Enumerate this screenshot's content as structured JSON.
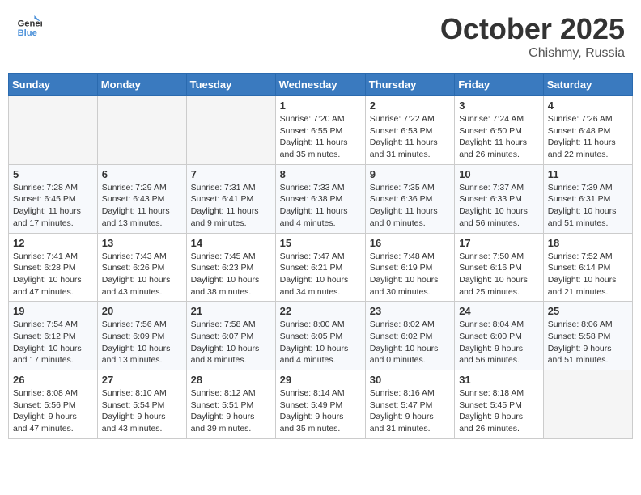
{
  "header": {
    "logo_line1": "General",
    "logo_line2": "Blue",
    "month": "October 2025",
    "location": "Chishmy, Russia"
  },
  "weekdays": [
    "Sunday",
    "Monday",
    "Tuesday",
    "Wednesday",
    "Thursday",
    "Friday",
    "Saturday"
  ],
  "weeks": [
    [
      {
        "day": "",
        "info": ""
      },
      {
        "day": "",
        "info": ""
      },
      {
        "day": "",
        "info": ""
      },
      {
        "day": "1",
        "info": "Sunrise: 7:20 AM\nSunset: 6:55 PM\nDaylight: 11 hours\nand 35 minutes."
      },
      {
        "day": "2",
        "info": "Sunrise: 7:22 AM\nSunset: 6:53 PM\nDaylight: 11 hours\nand 31 minutes."
      },
      {
        "day": "3",
        "info": "Sunrise: 7:24 AM\nSunset: 6:50 PM\nDaylight: 11 hours\nand 26 minutes."
      },
      {
        "day": "4",
        "info": "Sunrise: 7:26 AM\nSunset: 6:48 PM\nDaylight: 11 hours\nand 22 minutes."
      }
    ],
    [
      {
        "day": "5",
        "info": "Sunrise: 7:28 AM\nSunset: 6:45 PM\nDaylight: 11 hours\nand 17 minutes."
      },
      {
        "day": "6",
        "info": "Sunrise: 7:29 AM\nSunset: 6:43 PM\nDaylight: 11 hours\nand 13 minutes."
      },
      {
        "day": "7",
        "info": "Sunrise: 7:31 AM\nSunset: 6:41 PM\nDaylight: 11 hours\nand 9 minutes."
      },
      {
        "day": "8",
        "info": "Sunrise: 7:33 AM\nSunset: 6:38 PM\nDaylight: 11 hours\nand 4 minutes."
      },
      {
        "day": "9",
        "info": "Sunrise: 7:35 AM\nSunset: 6:36 PM\nDaylight: 11 hours\nand 0 minutes."
      },
      {
        "day": "10",
        "info": "Sunrise: 7:37 AM\nSunset: 6:33 PM\nDaylight: 10 hours\nand 56 minutes."
      },
      {
        "day": "11",
        "info": "Sunrise: 7:39 AM\nSunset: 6:31 PM\nDaylight: 10 hours\nand 51 minutes."
      }
    ],
    [
      {
        "day": "12",
        "info": "Sunrise: 7:41 AM\nSunset: 6:28 PM\nDaylight: 10 hours\nand 47 minutes."
      },
      {
        "day": "13",
        "info": "Sunrise: 7:43 AM\nSunset: 6:26 PM\nDaylight: 10 hours\nand 43 minutes."
      },
      {
        "day": "14",
        "info": "Sunrise: 7:45 AM\nSunset: 6:23 PM\nDaylight: 10 hours\nand 38 minutes."
      },
      {
        "day": "15",
        "info": "Sunrise: 7:47 AM\nSunset: 6:21 PM\nDaylight: 10 hours\nand 34 minutes."
      },
      {
        "day": "16",
        "info": "Sunrise: 7:48 AM\nSunset: 6:19 PM\nDaylight: 10 hours\nand 30 minutes."
      },
      {
        "day": "17",
        "info": "Sunrise: 7:50 AM\nSunset: 6:16 PM\nDaylight: 10 hours\nand 25 minutes."
      },
      {
        "day": "18",
        "info": "Sunrise: 7:52 AM\nSunset: 6:14 PM\nDaylight: 10 hours\nand 21 minutes."
      }
    ],
    [
      {
        "day": "19",
        "info": "Sunrise: 7:54 AM\nSunset: 6:12 PM\nDaylight: 10 hours\nand 17 minutes."
      },
      {
        "day": "20",
        "info": "Sunrise: 7:56 AM\nSunset: 6:09 PM\nDaylight: 10 hours\nand 13 minutes."
      },
      {
        "day": "21",
        "info": "Sunrise: 7:58 AM\nSunset: 6:07 PM\nDaylight: 10 hours\nand 8 minutes."
      },
      {
        "day": "22",
        "info": "Sunrise: 8:00 AM\nSunset: 6:05 PM\nDaylight: 10 hours\nand 4 minutes."
      },
      {
        "day": "23",
        "info": "Sunrise: 8:02 AM\nSunset: 6:02 PM\nDaylight: 10 hours\nand 0 minutes."
      },
      {
        "day": "24",
        "info": "Sunrise: 8:04 AM\nSunset: 6:00 PM\nDaylight: 9 hours\nand 56 minutes."
      },
      {
        "day": "25",
        "info": "Sunrise: 8:06 AM\nSunset: 5:58 PM\nDaylight: 9 hours\nand 51 minutes."
      }
    ],
    [
      {
        "day": "26",
        "info": "Sunrise: 8:08 AM\nSunset: 5:56 PM\nDaylight: 9 hours\nand 47 minutes."
      },
      {
        "day": "27",
        "info": "Sunrise: 8:10 AM\nSunset: 5:54 PM\nDaylight: 9 hours\nand 43 minutes."
      },
      {
        "day": "28",
        "info": "Sunrise: 8:12 AM\nSunset: 5:51 PM\nDaylight: 9 hours\nand 39 minutes."
      },
      {
        "day": "29",
        "info": "Sunrise: 8:14 AM\nSunset: 5:49 PM\nDaylight: 9 hours\nand 35 minutes."
      },
      {
        "day": "30",
        "info": "Sunrise: 8:16 AM\nSunset: 5:47 PM\nDaylight: 9 hours\nand 31 minutes."
      },
      {
        "day": "31",
        "info": "Sunrise: 8:18 AM\nSunset: 5:45 PM\nDaylight: 9 hours\nand 26 minutes."
      },
      {
        "day": "",
        "info": ""
      }
    ]
  ]
}
